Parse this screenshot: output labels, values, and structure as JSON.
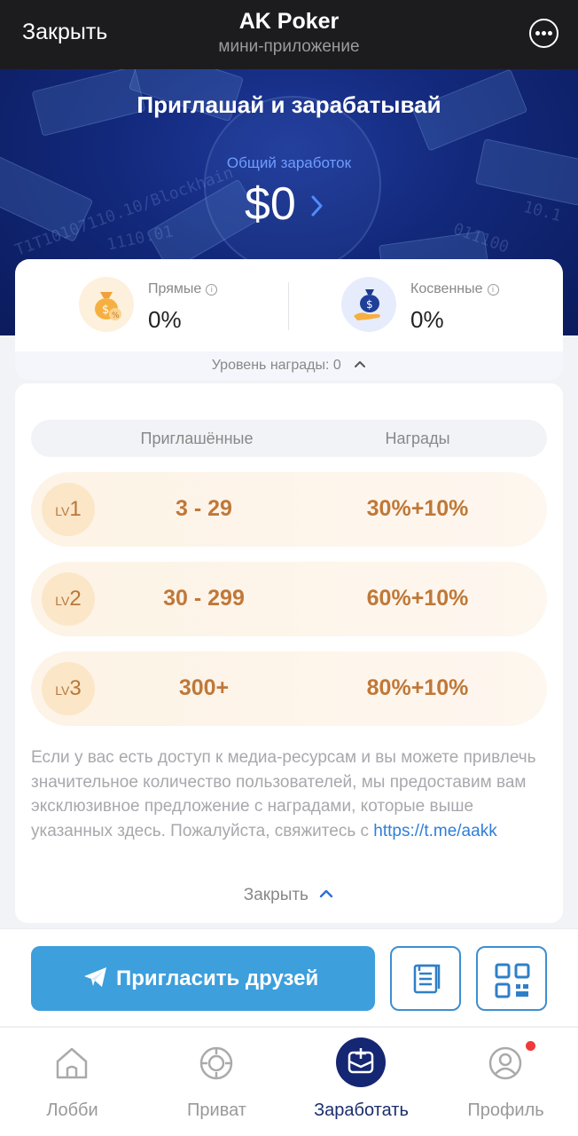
{
  "topbar": {
    "close_label": "Закрыть",
    "title": "AK Poker",
    "subtitle": "мини-приложение",
    "menu_icon": "more-icon"
  },
  "hero": {
    "title": "Приглашай и зарабатывай",
    "total_label": "Общий заработок",
    "total_value": "$0",
    "background_text_1": "T1T10107110.10/Blockhain",
    "background_text_2": "1110.01",
    "background_text_3": "10.1",
    "background_text_4": "011100"
  },
  "stats": {
    "direct": {
      "label": "Прямые",
      "value": "0%",
      "icon": "money-bag-percent-icon"
    },
    "indirect": {
      "label": "Косвенные",
      "value": "0%",
      "icon": "hand-money-bag-icon"
    },
    "reward_level": "Уровень награды: 0"
  },
  "levels": {
    "header": {
      "invited": "Приглашённые",
      "rewards": "Награды"
    },
    "rows": [
      {
        "lv": "LV",
        "num": "1",
        "invited": "3 - 29",
        "reward": "30%+10%"
      },
      {
        "lv": "LV",
        "num": "2",
        "invited": "30 - 299",
        "reward": "60%+10%"
      },
      {
        "lv": "LV",
        "num": "3",
        "invited": "300+",
        "reward": "80%+10%"
      }
    ],
    "note_text": "Если у вас есть доступ к медиа-ресурсам и вы можете привлечь значительное количество пользователей, мы предоставим вам эксклюзивное предложение с наградами, которые выше указанных здесь. Пожалуйста, свяжитесь с ",
    "note_link": "https://t.me/aakk",
    "collapse_label": "Закрыть"
  },
  "actions": {
    "invite_label": "Пригласить друзей",
    "copy_icon": "copy-icon",
    "qr_icon": "qr-code-icon"
  },
  "nav": {
    "items": [
      {
        "label": "Лобби",
        "icon": "home-icon"
      },
      {
        "label": "Приват",
        "icon": "poker-chip-icon"
      },
      {
        "label": "Заработать",
        "icon": "earn-icon",
        "active": true
      },
      {
        "label": "Профиль",
        "icon": "profile-icon"
      }
    ]
  },
  "colors": {
    "accent": "#3d9fdc",
    "nav_active": "#152673",
    "level_text": "#c07838",
    "hero": "#12287a"
  }
}
